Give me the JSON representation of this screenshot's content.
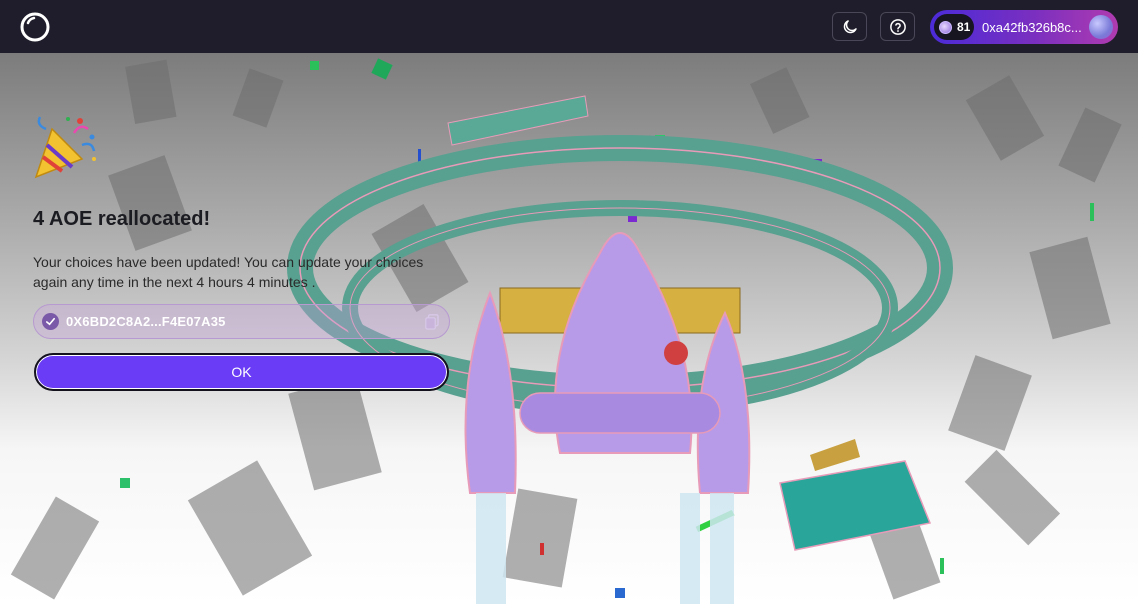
{
  "header": {
    "moon_icon": "moon-icon",
    "help_icon": "question-icon",
    "wallet": {
      "count": "81",
      "address": "0xa42fb326b8c..."
    }
  },
  "dialog": {
    "title": "4 AOE reallocated!",
    "description": "Your choices have been updated! You can update your choices again any time in the next 4 hours 4 minutes .",
    "tx_hash": "0X6BD2C8A2...F4E07A35",
    "ok_label": "OK"
  },
  "colors": {
    "topbar": "#1f1d2b",
    "accent": "#6a3cf5",
    "wallet_gradient_start": "#4b2bd8",
    "wallet_gradient_end": "#b03bb0"
  }
}
